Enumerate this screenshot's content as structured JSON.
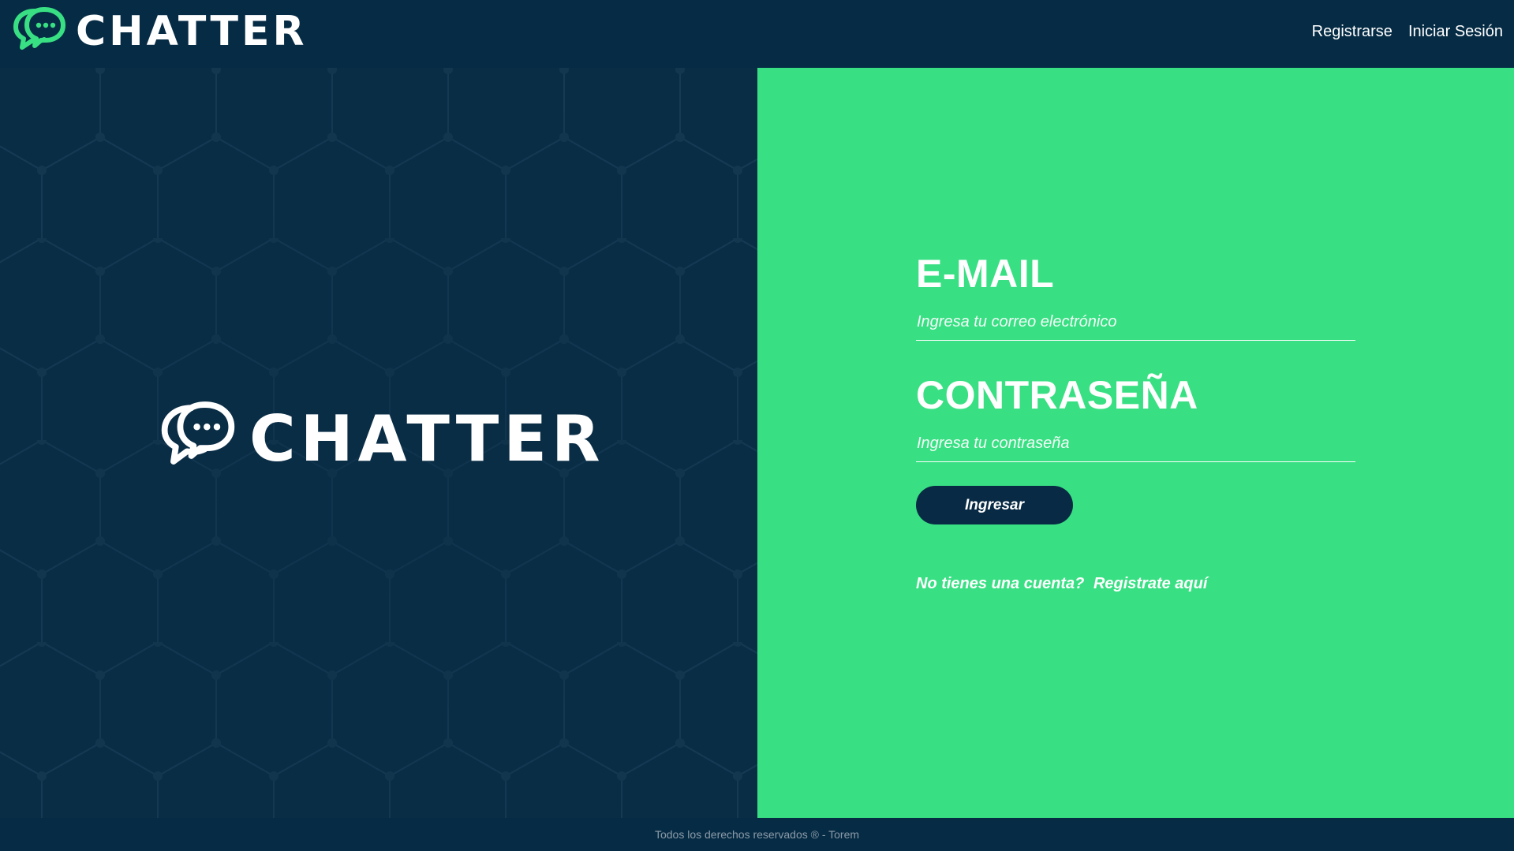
{
  "header": {
    "brand_name": "CHATTER",
    "nav": {
      "register": "Registrarse",
      "login": "Iniciar Sesión"
    }
  },
  "hero": {
    "brand_name": "CHATTER"
  },
  "login_form": {
    "email_title": "E-MAIL",
    "email_placeholder": "Ingresa tu correo electrónico",
    "password_title": "CONTRASEÑA",
    "password_placeholder": "Ingresa tu contraseña",
    "submit_label": "Ingresar",
    "no_account_text": "No tienes una cuenta?",
    "register_link": "Registrate aquí"
  },
  "footer": {
    "text": "Todos los derechos reservados ® - Torem"
  },
  "colors": {
    "header_bg": "#062c45",
    "hero_bg": "#0a2d46",
    "accent_green": "#38e083",
    "button_bg": "#082a44"
  },
  "icons": {
    "brand_logo": "chat-bubbles-icon"
  }
}
